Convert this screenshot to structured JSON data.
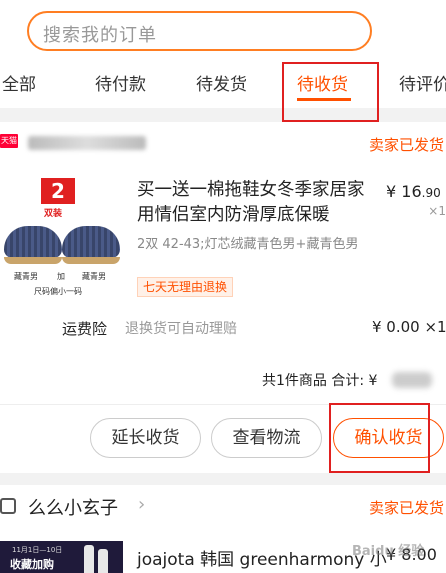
{
  "search": {
    "placeholder": "搜索我的订单"
  },
  "tabs": [
    {
      "label": "全部"
    },
    {
      "label": "待付款"
    },
    {
      "label": "待发货"
    },
    {
      "label": "待收货"
    },
    {
      "label": "待评价"
    }
  ],
  "active_tab": "待收货",
  "colors": {
    "accent": "#ff5000",
    "highlight_frame": "#e02020",
    "tmall": "#ff0036"
  },
  "orders": [
    {
      "store_badge": "天猫",
      "status": "卖家已发货",
      "item": {
        "thumb_badge_number": "2",
        "thumb_badge_text": "双装",
        "thumb_caption_left": "藏青男",
        "thumb_caption_mid": "加",
        "thumb_caption_right": "藏青男",
        "thumb_caption_bottom": "尺码偏小一码",
        "title": "买一送一棉拖鞋女冬季家居家用情侣室内防滑厚底保暖",
        "price_symbol": "¥",
        "price_int": "16",
        "price_dec": ".90",
        "quantity": "×1",
        "sku": "2双 42-43;灯芯绒藏青色男+藏青色男",
        "tag": "七天无理由退换"
      },
      "insurance": {
        "label": "运费险",
        "desc": "退换货可自动理赔",
        "price": "¥ 0.00 ×1"
      },
      "summary_text": "共1件商品 合计: ¥",
      "buttons": {
        "extend": "延长收货",
        "logistics": "查看物流",
        "confirm": "确认收货"
      }
    },
    {
      "shop_name": "么么小玄子",
      "chevron": "›",
      "status": "卖家已发货",
      "thumb_text_top": "11月1日—10日",
      "thumb_text_main": "收藏加购",
      "title": "joajota 韩国 greenharmony 小",
      "price": "¥ 8.00"
    }
  ],
  "watermark": "Baidu 经验"
}
